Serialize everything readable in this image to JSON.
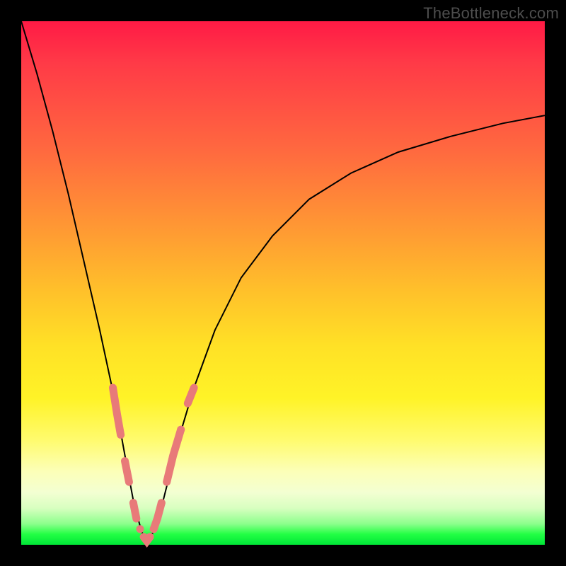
{
  "watermark": "TheBottleneck.com",
  "colors": {
    "curve": "#000000",
    "accent": "#e87a79",
    "gradient_top": "#ff1a45",
    "gradient_bottom": "#00e637",
    "frame": "#000000"
  },
  "chart_data": {
    "type": "line",
    "title": "",
    "xlabel": "",
    "ylabel": "",
    "xlim": [
      0,
      100
    ],
    "ylim": [
      0,
      100
    ],
    "grid": false,
    "legend": false,
    "annotations": [
      "TheBottleneck.com"
    ],
    "description": "Single V-shaped bottleneck curve on rainbow gradient background; minimum near x≈24, right arm asymptotically flattens toward y≈82.",
    "series": [
      {
        "name": "bottleneck-curve",
        "x": [
          0,
          3,
          6,
          9,
          12,
          15,
          18,
          20,
          21.5,
          23,
          24,
          25,
          26.5,
          28,
          30,
          33,
          37,
          42,
          48,
          55,
          63,
          72,
          82,
          92,
          100
        ],
        "y": [
          100,
          90,
          79,
          67,
          54,
          41,
          27,
          16,
          8,
          2.5,
          0.5,
          2,
          6,
          12,
          20,
          30,
          41,
          51,
          59,
          66,
          71,
          75,
          78,
          80.5,
          82
        ]
      }
    ],
    "accent_markers": {
      "color": "#e87a79",
      "note": "Thick salmon dashes/dots overlaid on both flanks of the valley between roughly y=8 and y=30",
      "points": [
        {
          "x": 17.5,
          "y": 30
        },
        {
          "x": 18.3,
          "y": 25
        },
        {
          "x": 19.0,
          "y": 21
        },
        {
          "x": 19.8,
          "y": 16
        },
        {
          "x": 20.6,
          "y": 12
        },
        {
          "x": 21.4,
          "y": 8
        },
        {
          "x": 22.0,
          "y": 5
        },
        {
          "x": 22.7,
          "y": 3
        },
        {
          "x": 23.4,
          "y": 1.5
        },
        {
          "x": 24.0,
          "y": 0.7
        },
        {
          "x": 24.6,
          "y": 1.5
        },
        {
          "x": 25.3,
          "y": 3
        },
        {
          "x": 26.0,
          "y": 5
        },
        {
          "x": 26.8,
          "y": 8
        },
        {
          "x": 27.8,
          "y": 12
        },
        {
          "x": 29.0,
          "y": 17
        },
        {
          "x": 30.5,
          "y": 22
        },
        {
          "x": 31.8,
          "y": 27
        },
        {
          "x": 33.0,
          "y": 30
        }
      ]
    }
  }
}
